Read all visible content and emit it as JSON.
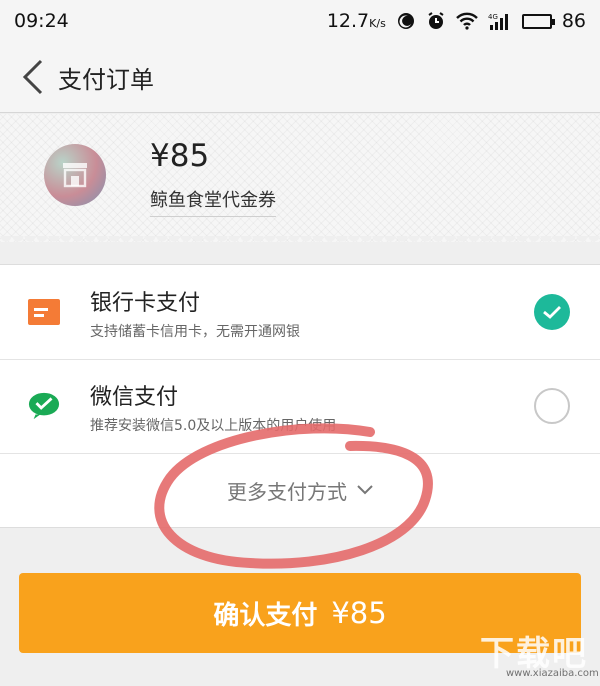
{
  "status_bar": {
    "time": "09:24",
    "speed": "12.7",
    "speed_unit": "K/s",
    "network": "4G",
    "battery": "86"
  },
  "nav": {
    "title": "支付订单"
  },
  "order": {
    "amount": "¥85",
    "name": "鲸鱼食堂代金券"
  },
  "payment_methods": [
    {
      "title": "银行卡支付",
      "desc": "支持储蓄卡信用卡，无需开通网银",
      "selected": true,
      "icon": "bank-card-icon"
    },
    {
      "title": "微信支付",
      "desc": "推荐安装微信5.0及以上版本的用户使用",
      "selected": false,
      "icon": "wechat-icon"
    }
  ],
  "more_methods": {
    "label": "更多支付方式"
  },
  "confirm": {
    "label": "确认支付",
    "amount": "¥85"
  },
  "watermark": {
    "text": "下载吧",
    "url": "www.xiazaiba.com"
  },
  "colors": {
    "accent": "#f9a21c",
    "check": "#1db99a",
    "bank_icon": "#f47b36",
    "wechat": "#1aaa55",
    "annotation": "#e46a6a"
  }
}
